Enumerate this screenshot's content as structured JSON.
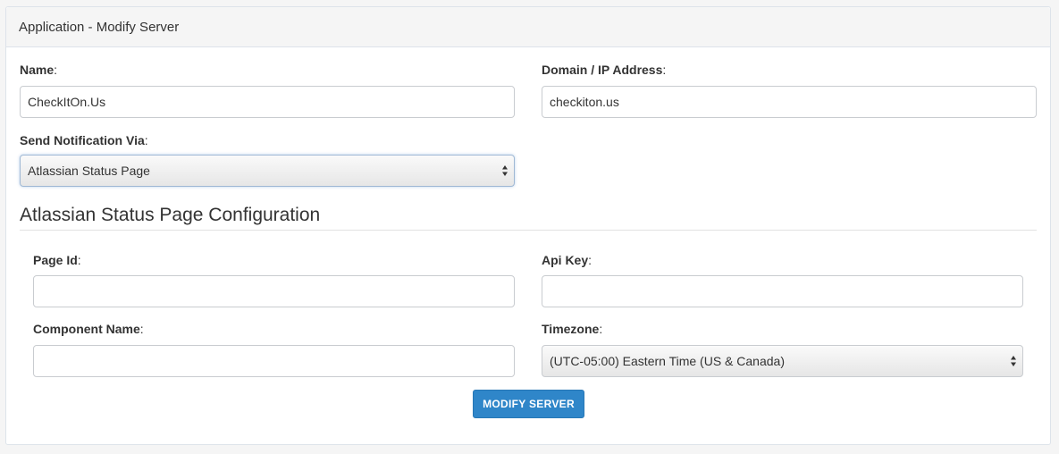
{
  "panel": {
    "title": "Application - Modify Server"
  },
  "form": {
    "name": {
      "label": "Name",
      "value": "CheckItOn.Us"
    },
    "domain": {
      "label": "Domain / IP Address",
      "value": "checkiton.us"
    },
    "notify": {
      "label": "Send Notification Via",
      "selected": "Atlassian Status Page"
    }
  },
  "config": {
    "title": "Atlassian Status Page Configuration",
    "page_id": {
      "label": "Page Id",
      "value": ""
    },
    "api_key": {
      "label": "Api Key",
      "value": ""
    },
    "component_name": {
      "label": "Component Name",
      "value": ""
    },
    "timezone": {
      "label": "Timezone",
      "selected": "(UTC-05:00) Eastern Time (US & Canada)"
    }
  },
  "punct": {
    "colon": ":"
  },
  "submit": {
    "label": "MODIFY SERVER"
  },
  "colors": {
    "primary": "#2f86c9",
    "focus_border": "#9fb8d4"
  },
  "icons": {
    "select_arrows": "up-down-arrows-icon"
  }
}
